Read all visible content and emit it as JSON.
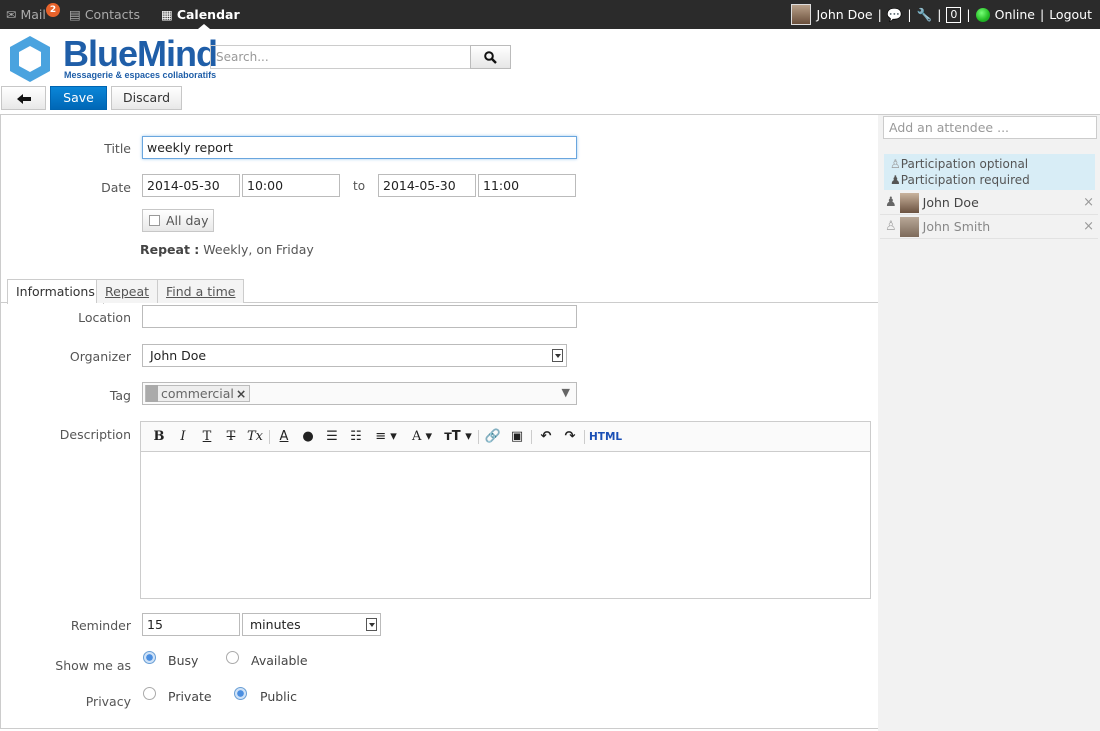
{
  "topbar": {
    "apps": [
      {
        "label": "Mail",
        "badge": "2"
      },
      {
        "label": "Contacts"
      },
      {
        "label": "Calendar"
      }
    ],
    "user_name": "John Doe",
    "counter": "0",
    "status": "Online",
    "logout": "Logout",
    "separator": "|"
  },
  "logo": {
    "name": "BlueMind",
    "tagline": "Messagerie & espaces collaboratifs"
  },
  "search": {
    "placeholder": "Search..."
  },
  "actions": {
    "save": "Save",
    "discard": "Discard"
  },
  "form": {
    "title_label": "Title",
    "title_value": "weekly report",
    "date_label": "Date",
    "start_date": "2014-05-30",
    "start_time": "10:00",
    "to_label": "to",
    "end_date": "2014-05-30",
    "end_time": "11:00",
    "all_day": "All day",
    "repeat_label": "Repeat :",
    "repeat_value": "Weekly, on Friday"
  },
  "tabs": [
    "Informations",
    "Repeat",
    "Find a time"
  ],
  "info": {
    "location_label": "Location",
    "location_value": "",
    "organizer_label": "Organizer",
    "organizer_value": "John Doe",
    "tag_label": "Tag",
    "tag_value": "commercial",
    "description_label": "Description",
    "html_button": "HTML",
    "reminder_label": "Reminder",
    "reminder_value": "15",
    "reminder_unit": "minutes",
    "show_me_as_label": "Show me as",
    "busy": "Busy",
    "available": "Available",
    "privacy_label": "Privacy",
    "private": "Private",
    "public": "Public"
  },
  "attendees": {
    "placeholder": "Add an attendee ...",
    "legend_optional": "Participation optional",
    "legend_required": "Participation required",
    "list": [
      {
        "name": "John Doe",
        "required": true
      },
      {
        "name": "John Smith",
        "required": false
      }
    ]
  },
  "colors": {
    "accent": "#0a78cb",
    "topbar": "#2b2b2b",
    "legend_bg": "#d8edf6",
    "logo": "#1f5ea8"
  }
}
